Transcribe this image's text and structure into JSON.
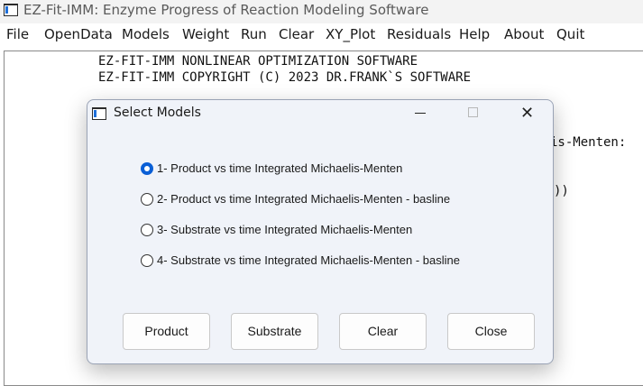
{
  "window": {
    "title": "EZ-Fit-IMM: Enzyme Progress of Reaction Modeling Software"
  },
  "menu": {
    "items": [
      "File",
      "OpenData",
      "Models",
      "Weight",
      "Run",
      "Clear",
      "XY_Plot",
      "Residuals",
      "Help",
      "About",
      "Quit"
    ]
  },
  "console": {
    "lines": [
      "EZ-FIT-IMM NONLINEAR OPTIMIZATION SOFTWARE",
      "EZ-FIT-IMM COPYRIGHT (C) 2023 DR.FRANK`S SOFTWARE"
    ],
    "partial_right_1": "is-Menten:",
    "partial_right_2": "))"
  },
  "dialog": {
    "title": "Select Models",
    "options": [
      "1- Product vs time Integrated Michaelis-Menten",
      "2- Product vs time Integrated Michaelis-Menten - basline",
      "3- Substrate vs time Integrated Michaelis-Menten",
      "4- Substrate vs time Integrated Michaelis-Menten - basline"
    ],
    "selected_option": 1,
    "buttons": {
      "product": "Product",
      "substrate": "Substrate",
      "clear": "Clear",
      "close": "Close"
    }
  },
  "colors": {
    "accent": "#0a5fd6",
    "dialog_bg": "#f0f3f9",
    "titlebar_bg": "#f3f3f3"
  }
}
